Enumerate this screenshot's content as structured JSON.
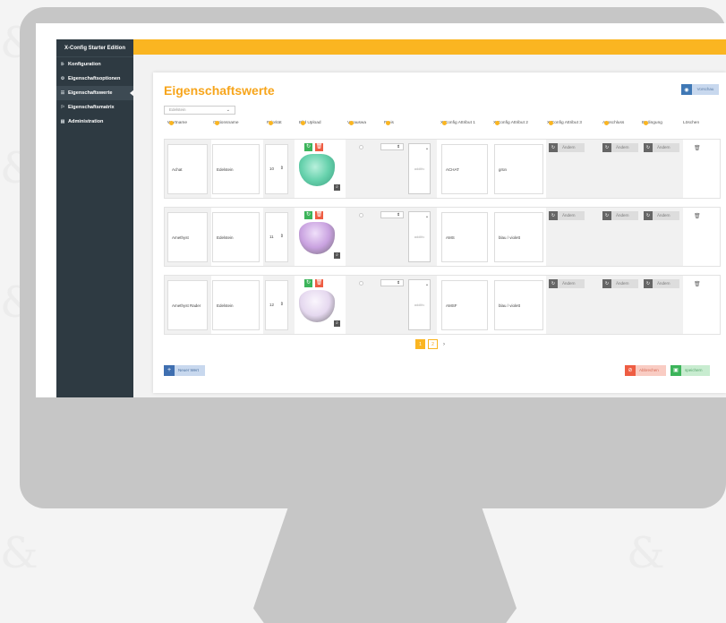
{
  "app": {
    "title": "X-Config Starter Edition"
  },
  "sidebar": {
    "items": [
      {
        "label": "Konfiguration",
        "icon": "sliders-icon"
      },
      {
        "label": "Eigenschaftsoptionen",
        "icon": "gear-icon"
      },
      {
        "label": "Eigenschaftswerte",
        "icon": "list-icon",
        "active": true
      },
      {
        "label": "Eigenschaftsmatrix",
        "icon": "flag-icon"
      },
      {
        "label": "Administration",
        "icon": "table-icon"
      }
    ]
  },
  "page": {
    "title": "Eigenschaftswerte",
    "preview_label": "Vorschau",
    "filter": {
      "value": "Edelstein"
    }
  },
  "table": {
    "headers": {
      "wertname": "Wertname",
      "optionsname": "Optionsname",
      "prioritaet": "Priorität",
      "bild": "Bild Upload",
      "voraus": "Vorauswa",
      "preis": "Preis",
      "attr1": "X-Config Attribut 1",
      "attr2": "X-Config Attribut 2",
      "attr3": "X-Config Attribut 3",
      "ausschluss": "Ausschluss",
      "bedingung": "Bedingung",
      "loeschen": "Löschen"
    },
    "rows": [
      {
        "wertname": "Achat",
        "optionsname": "Edelstein",
        "prioritaet": "10",
        "price_placeholder": "additiv",
        "attr1": "ACHAT",
        "attr2": "grün",
        "gem_color": "#66d1ac"
      },
      {
        "wertname": "Amethyst",
        "optionsname": "Edelstein",
        "prioritaet": "11",
        "price_placeholder": "additiv",
        "attr1": "AMS",
        "attr2": "blau / violett",
        "gem_color": "#c9a2e0"
      },
      {
        "wertname": "Amethyst Rader",
        "optionsname": "Edelstein",
        "prioritaet": "12",
        "price_placeholder": "additiv",
        "attr1": "AMSF",
        "attr2": "blau / violett",
        "gem_color": "#e5d8ef"
      }
    ],
    "action_label": "Ändern"
  },
  "pagination": {
    "pages": [
      "1",
      "2"
    ],
    "next": "›"
  },
  "footer": {
    "add_label": "Neuer Wert",
    "cancel_label": "Abbrechen",
    "save_label": "speichern"
  },
  "colors": {
    "accent": "#fab521",
    "sidebar": "#2e3a42",
    "primary": "#3f78b5",
    "success": "#3cb45a",
    "danger": "#ee5d43"
  }
}
